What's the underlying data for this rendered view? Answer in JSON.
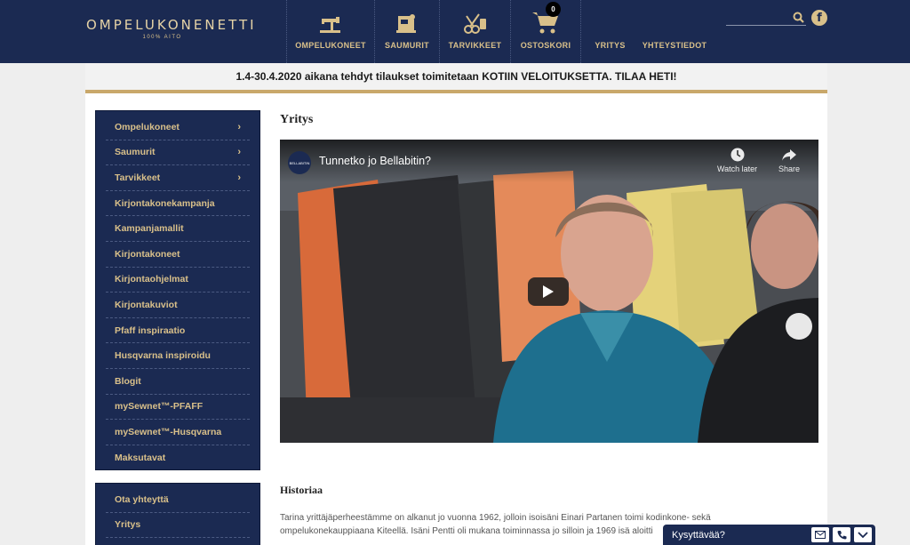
{
  "header": {
    "logo_main": "OMPELUKONENETTI",
    "logo_sub": "100% AITO",
    "nav": [
      {
        "label": "OMPELUKONEET",
        "icon": "sewing-machine-icon"
      },
      {
        "label": "SAUMURIT",
        "icon": "overlock-icon"
      },
      {
        "label": "TARVIKKEET",
        "icon": "scissors-thread-icon"
      },
      {
        "label": "OSTOSKORI",
        "icon": "cart-icon",
        "badge": "0"
      },
      {
        "label": "YRITYS"
      },
      {
        "label": "YHTEYSTIEDOT"
      }
    ],
    "search_placeholder": "",
    "facebook_glyph": "f"
  },
  "announcement": "1.4-30.4.2020 aikana tehdyt tilaukset toimitetaan KOTIIN VELOITUKSETTA. TILAA HETI!",
  "sidebar": {
    "items": [
      {
        "label": "Ompelukoneet",
        "chevron": "›"
      },
      {
        "label": "Saumurit",
        "chevron": "›"
      },
      {
        "label": "Tarvikkeet",
        "chevron": "›"
      },
      {
        "label": "Kirjontakonekampanja"
      },
      {
        "label": "Kampanjamallit"
      },
      {
        "label": "Kirjontakoneet"
      },
      {
        "label": "Kirjontaohjelmat"
      },
      {
        "label": "Kirjontakuviot"
      },
      {
        "label": "Pfaff inspiraatio"
      },
      {
        "label": "Husqvarna inspiroidu"
      },
      {
        "label": "Blogit"
      },
      {
        "label": "mySewnet™-PFAFF"
      },
      {
        "label": "mySewnet™-Husqvarna"
      },
      {
        "label": "Maksutavat"
      }
    ],
    "items2": [
      {
        "label": "Ota yhteyttä"
      },
      {
        "label": "Yritys"
      },
      {
        "label": ""
      }
    ]
  },
  "main": {
    "title": "Yritys",
    "video": {
      "channel": "BELLABITIN",
      "title": "Tunnetko jo Bellabitin?",
      "watch_later": "Watch later",
      "share": "Share"
    },
    "history_heading": "Historiaa",
    "history_text": "Tarina yrittäjäperheestämme on alkanut jo vuonna 1962, jolloin isoisäni Einari Partanen toimi kodinkone- sekä ompelukonekauppiaana Kiteellä. Isäni Pentti oli mukana toiminnassa jo silloin ja 1969 isä aloitti"
  },
  "chat": {
    "label": "Kysyttävää?"
  },
  "colors": {
    "navy": "#1b2a52",
    "gold": "#d9c08a",
    "gold_rule": "#c9a86a"
  }
}
